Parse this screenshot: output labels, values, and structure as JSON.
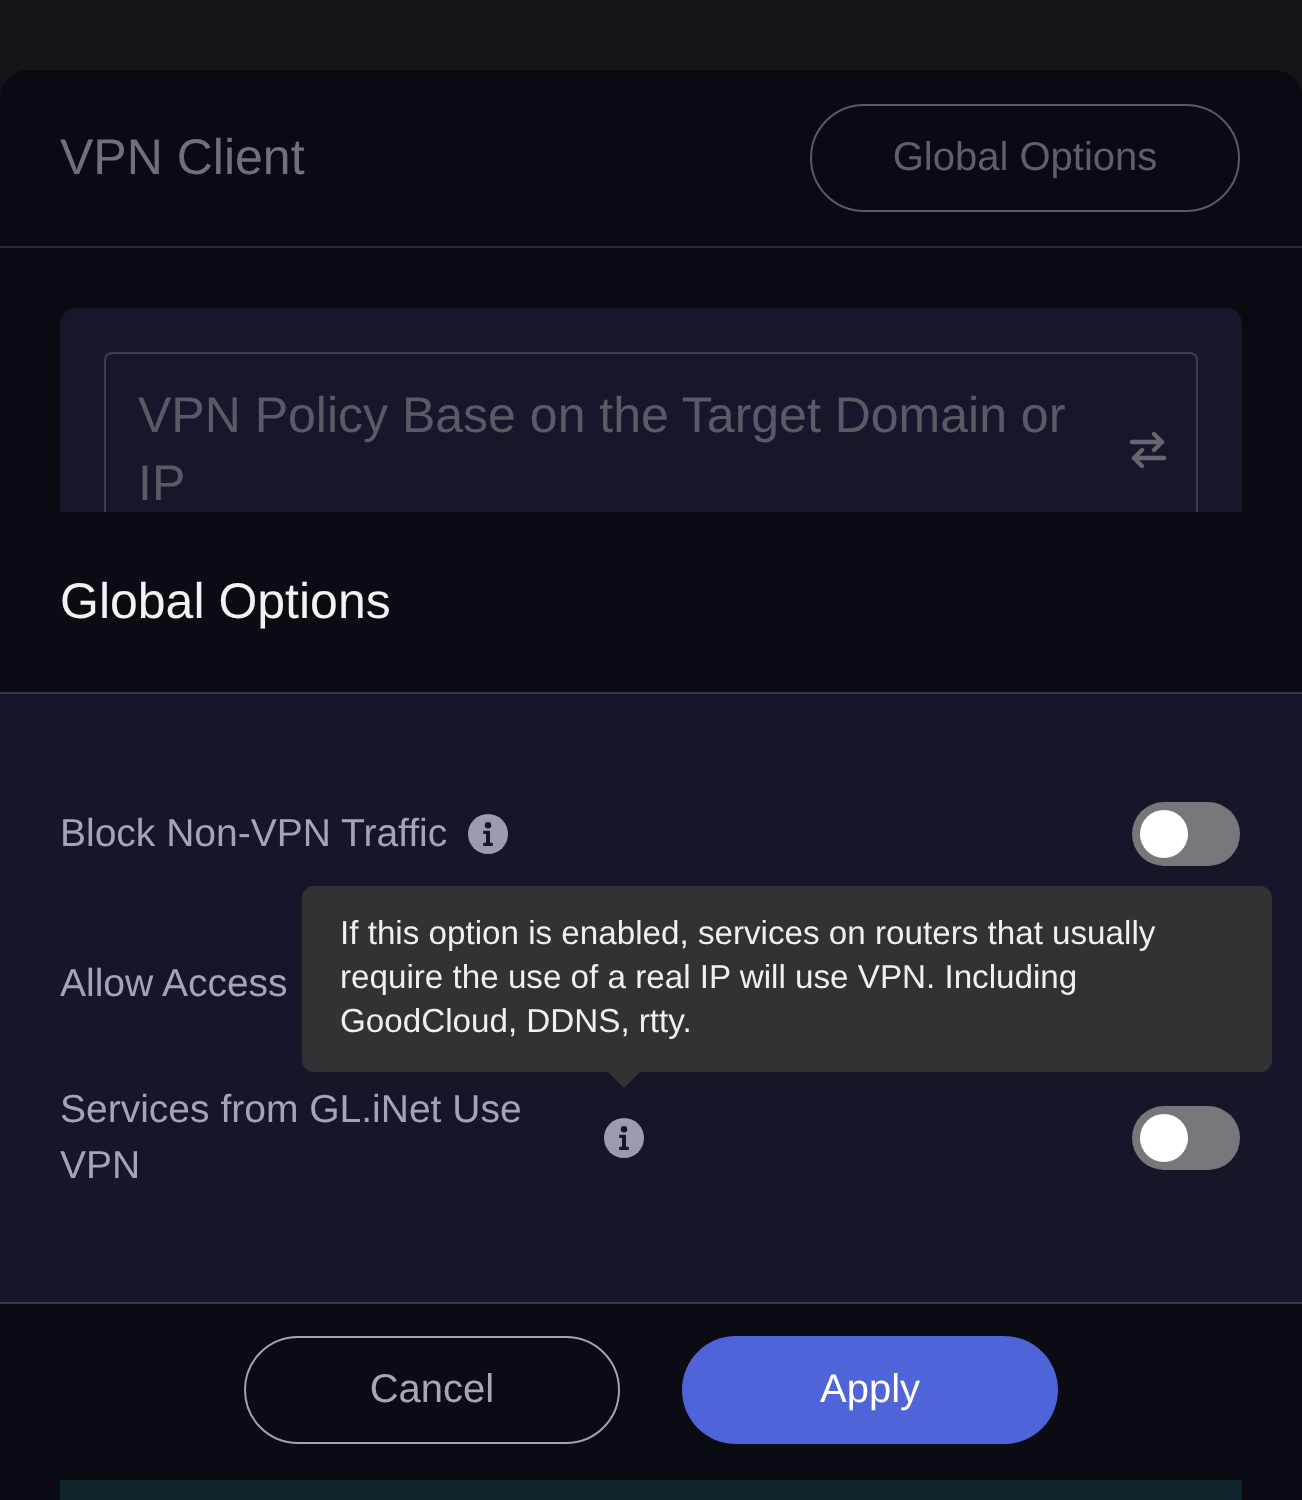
{
  "background_page": {
    "title": "VPN Client",
    "global_options_button": "Global Options",
    "policy_field": {
      "value": "VPN Policy Base on the Target Domain or IP"
    }
  },
  "dialog": {
    "title": "Global Options",
    "options": [
      {
        "label": "Block Non-VPN Traffic",
        "info": true,
        "on": false
      },
      {
        "label": "Allow Access",
        "info": false
      },
      {
        "label": "Services from GL.iNet Use VPN",
        "info": true,
        "on": false
      }
    ],
    "tooltip": "If this option is enabled, services on routers that usually require the use of a real IP will use VPN. Including GoodCloud, DDNS, rtty.",
    "buttons": [
      {
        "label": "Cancel",
        "kind": "secondary"
      },
      {
        "label": "Apply",
        "kind": "primary"
      }
    ]
  }
}
